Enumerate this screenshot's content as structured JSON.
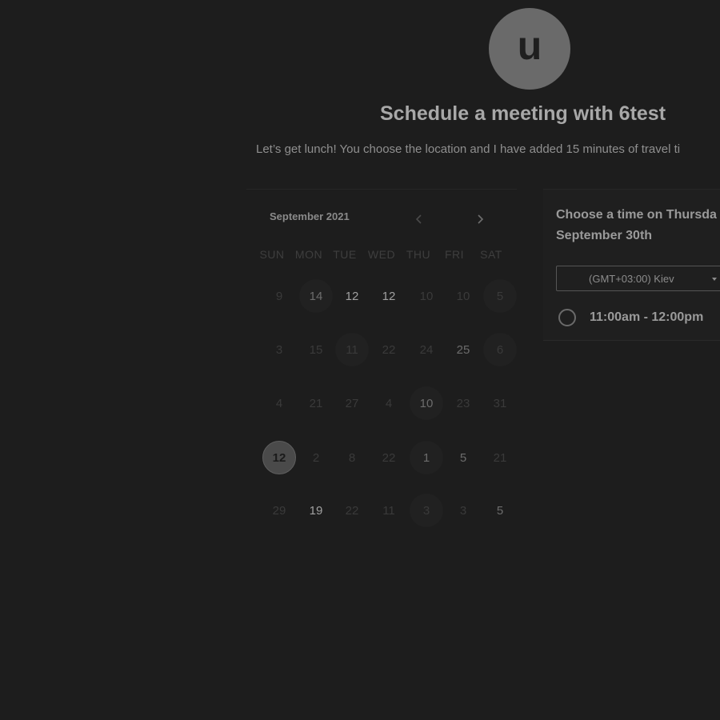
{
  "header": {
    "avatar_letter": "u",
    "title": "Schedule a meeting with 6test",
    "subtitle": "Let’s get lunch! You choose the location and I have added 15 minutes of travel ti"
  },
  "calendar": {
    "month_label": "September 2021",
    "prev_icon": "chevron-left-icon",
    "next_icon": "chevron-right-icon",
    "weekdays": [
      "SUN",
      "MON",
      "TUE",
      "WED",
      "THU",
      "FRI",
      "SAT"
    ],
    "weeks": [
      [
        "9",
        "14",
        "12",
        "12",
        "10",
        "10",
        "5"
      ],
      [
        "3",
        "15",
        "11",
        "22",
        "24",
        "25",
        "6"
      ],
      [
        "4",
        "21",
        "27",
        "4",
        "10",
        "23",
        "31"
      ],
      [
        "12",
        "2",
        "8",
        "22",
        "1",
        "5",
        "21"
      ],
      [
        "29",
        "19",
        "22",
        "11",
        "3",
        "3",
        "5"
      ]
    ],
    "selected_day": "12"
  },
  "time_panel": {
    "title": "Choose a time on Thursda September 30th",
    "timezone": "(GMT+03:00) Kiev",
    "slots": [
      {
        "label": "11:00am - 12:00pm"
      }
    ]
  },
  "colors": {
    "background": "#1d1d1d",
    "avatar": "#6a6a6a",
    "title_text": "#a8a8a8",
    "selected_day": "#4a4a4a"
  }
}
